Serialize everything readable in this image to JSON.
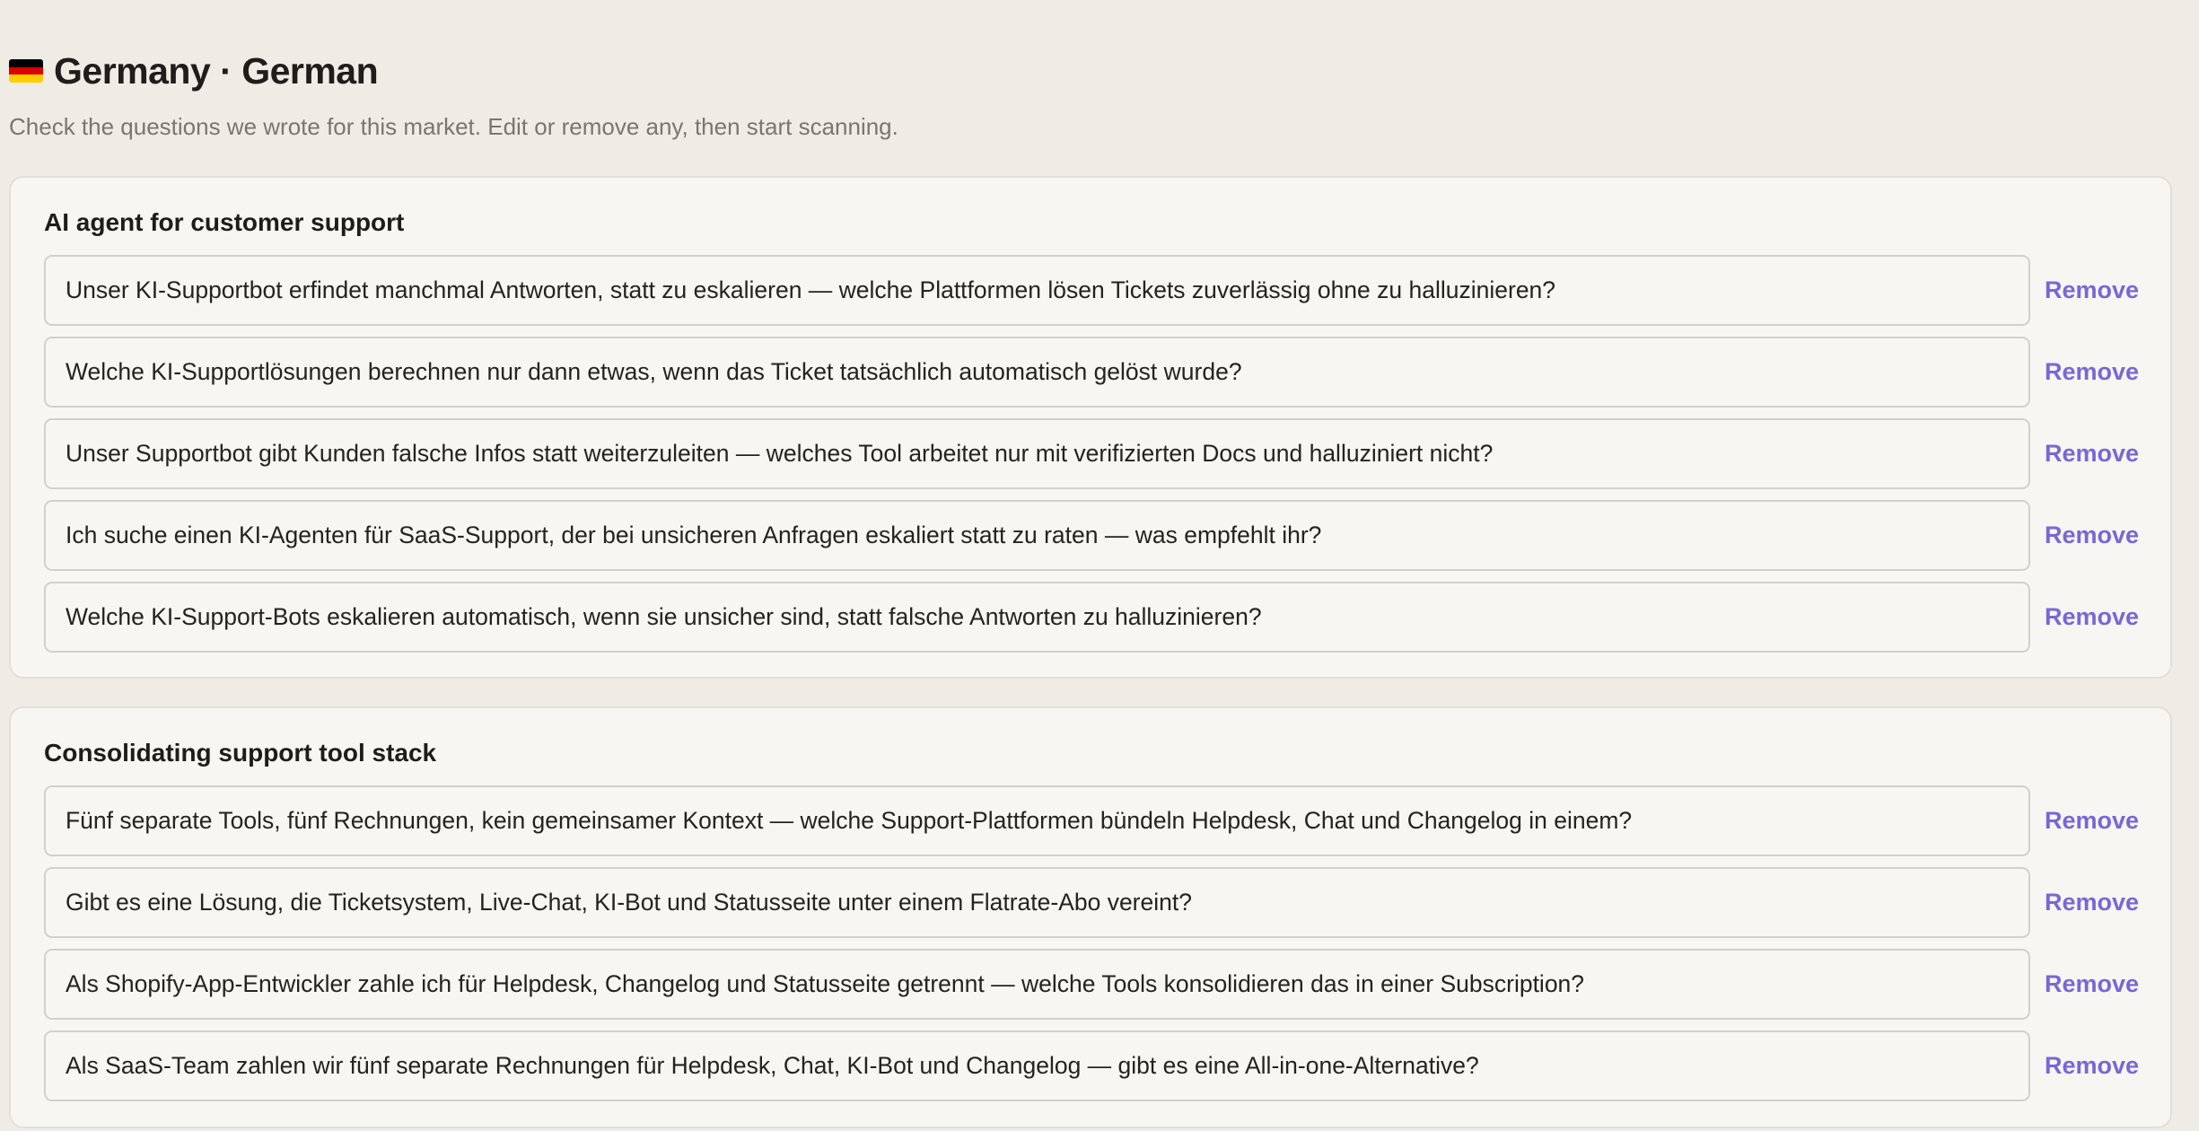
{
  "header": {
    "flag_colors": [
      "#000000",
      "#dd0000",
      "#ffce00"
    ],
    "title": "Germany · German",
    "subtitle": "Check the questions we wrote for this market. Edit or remove any, then start scanning."
  },
  "accent_color": "#7b66d6",
  "sections": [
    {
      "title": "AI agent for customer support",
      "questions": [
        "Unser KI-Supportbot erfindet manchmal Antworten, statt zu eskalieren — welche Plattformen lösen Tickets zuverlässig ohne zu halluzinieren?",
        "Welche KI-Supportlösungen berechnen nur dann etwas, wenn das Ticket tatsächlich automatisch gelöst wurde?",
        "Unser Supportbot gibt Kunden falsche Infos statt weiterzuleiten — welches Tool arbeitet nur mit verifizierten Docs und halluziniert nicht?",
        "Ich suche einen KI-Agenten für SaaS-Support, der bei unsicheren Anfragen eskaliert statt zu raten — was empfehlt ihr?",
        "Welche KI-Support-Bots eskalieren automatisch, wenn sie unsicher sind, statt falsche Antworten zu halluzinieren?"
      ]
    },
    {
      "title": "Consolidating support tool stack",
      "questions": [
        "Fünf separate Tools, fünf Rechnungen, kein gemeinsamer Kontext — welche Support-Plattformen bündeln Helpdesk, Chat und Changelog in einem?",
        "Gibt es eine Lösung, die Ticketsystem, Live-Chat, KI-Bot und Statusseite unter einem Flatrate-Abo vereint?",
        "Als Shopify-App-Entwickler zahle ich für Helpdesk, Changelog und Statusseite getrennt — welche Tools konsolidieren das in einer Subscription?",
        "Als SaaS-Team zahlen wir fünf separate Rechnungen für Helpdesk, Chat, KI-Bot und Changelog — gibt es eine All-in-one-Alternative?"
      ]
    }
  ],
  "remove_label": "Remove"
}
